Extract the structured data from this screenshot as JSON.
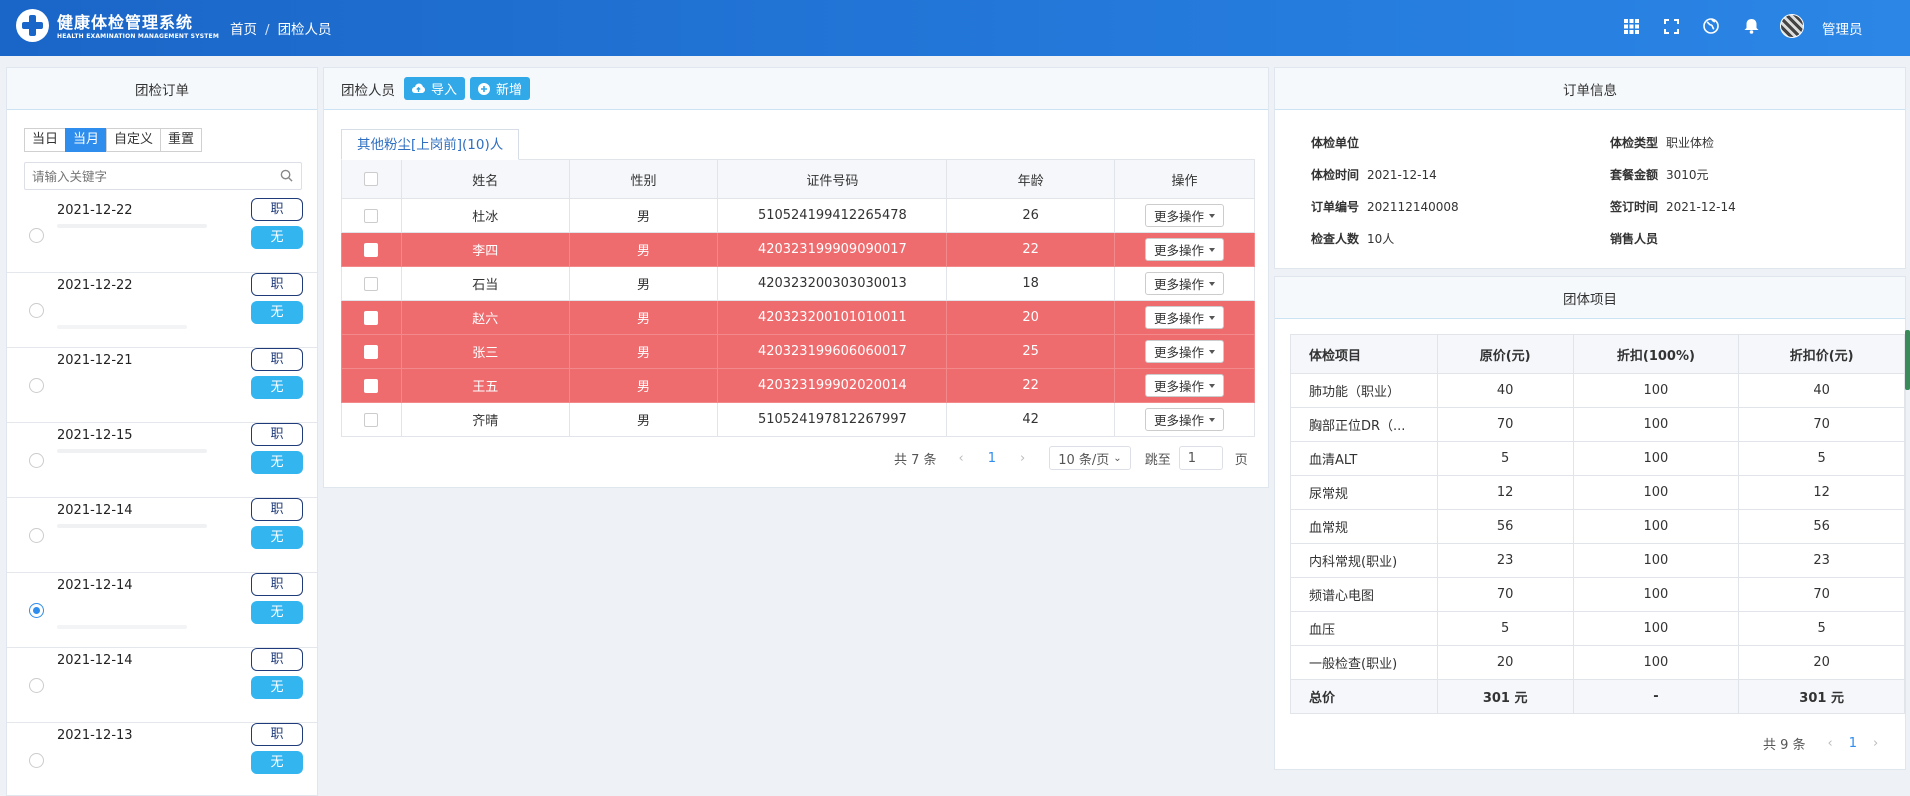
{
  "app": {
    "title": "健康体检管理系统",
    "subtitle": "HEALTH EXAMINATION MANAGEMENT SYSTEM"
  },
  "breadcrumb": {
    "home": "首页",
    "separator": "/",
    "current": "团检人员"
  },
  "header": {
    "user": "管理员",
    "icons": [
      "grid-icon",
      "fullscreen-icon",
      "globe-icon",
      "bell-icon"
    ]
  },
  "left": {
    "title": "团检订单",
    "tabs": [
      "当日",
      "当月",
      "自定义",
      "重置"
    ],
    "active_tab": "当月",
    "search_placeholder": "请输入关键字",
    "orders": [
      {
        "date": "2021-12-22",
        "tag1": "职",
        "tag2": "无",
        "selected": false
      },
      {
        "date": "2021-12-22",
        "tag1": "职",
        "tag2": "无",
        "selected": false
      },
      {
        "date": "2021-12-21",
        "tag1": "职",
        "tag2": "无",
        "selected": false
      },
      {
        "date": "2021-12-15",
        "tag1": "职",
        "tag2": "无",
        "selected": false
      },
      {
        "date": "2021-12-14",
        "tag1": "职",
        "tag2": "无",
        "selected": false
      },
      {
        "date": "2021-12-14",
        "tag1": "职",
        "tag2": "无",
        "selected": true
      },
      {
        "date": "2021-12-14",
        "tag1": "职",
        "tag2": "无",
        "selected": false
      },
      {
        "date": "2021-12-13",
        "tag1": "职",
        "tag2": "无",
        "selected": false
      }
    ]
  },
  "middle": {
    "title": "团检人员",
    "import_label": "导入",
    "add_label": "新增",
    "group_tab": "其他粉尘[上岗前](10)人",
    "columns": [
      "姓名",
      "性别",
      "证件号码",
      "年龄",
      "操作"
    ],
    "rows": [
      {
        "name": "杜冰",
        "gender": "男",
        "id": "510524199412265478",
        "age": "26",
        "action": "更多操作",
        "highlight": false
      },
      {
        "name": "李四",
        "gender": "男",
        "id": "420323199909090017",
        "age": "22",
        "action": "更多操作",
        "highlight": true
      },
      {
        "name": "石当",
        "gender": "男",
        "id": "420323200303030013",
        "age": "18",
        "action": "更多操作",
        "highlight": false
      },
      {
        "name": "赵六",
        "gender": "男",
        "id": "420323200101010011",
        "age": "20",
        "action": "更多操作",
        "highlight": true
      },
      {
        "name": "张三",
        "gender": "男",
        "id": "420323199606060017",
        "age": "25",
        "action": "更多操作",
        "highlight": true
      },
      {
        "name": "王五",
        "gender": "男",
        "id": "420323199902020014",
        "age": "22",
        "action": "更多操作",
        "highlight": true
      },
      {
        "name": "齐晴",
        "gender": "男",
        "id": "510524197812267997",
        "age": "42",
        "action": "更多操作",
        "highlight": false
      }
    ],
    "pager": {
      "total": "共 7 条",
      "prev": "‹",
      "page": "1",
      "next": "›",
      "size": "10 条/页",
      "goto": "跳至",
      "goto_value": "1",
      "unit": "页"
    }
  },
  "order_info": {
    "title": "订单信息",
    "fields": [
      {
        "label": "体检单位",
        "value": ""
      },
      {
        "label": "体检类型",
        "value": "职业体检"
      },
      {
        "label": "体检时间",
        "value": "2021-12-14"
      },
      {
        "label": "套餐金额",
        "value": "3010元"
      },
      {
        "label": "订单编号",
        "value": "202112140008"
      },
      {
        "label": "签订时间",
        "value": "2021-12-14"
      },
      {
        "label": "检查人数",
        "value": "10人"
      },
      {
        "label": "销售人员",
        "value": ""
      }
    ]
  },
  "group_items": {
    "title": "团体项目",
    "columns": [
      "体检项目",
      "原价(元)",
      "折扣(100%)",
      "折扣价(元)"
    ],
    "rows": [
      {
        "item": "肺功能（职业）",
        "price": "40",
        "discount": "100",
        "final": "40"
      },
      {
        "item": "胸部正位DR（...",
        "price": "70",
        "discount": "100",
        "final": "70"
      },
      {
        "item": "血清ALT",
        "price": "5",
        "discount": "100",
        "final": "5"
      },
      {
        "item": "尿常规",
        "price": "12",
        "discount": "100",
        "final": "12"
      },
      {
        "item": "血常规",
        "price": "56",
        "discount": "100",
        "final": "56"
      },
      {
        "item": "内科常规(职业)",
        "price": "23",
        "discount": "100",
        "final": "23"
      },
      {
        "item": "频谱心电图",
        "price": "70",
        "discount": "100",
        "final": "70"
      },
      {
        "item": "血压",
        "price": "5",
        "discount": "100",
        "final": "5"
      },
      {
        "item": "一般检查(职业)",
        "price": "20",
        "discount": "100",
        "final": "20"
      }
    ],
    "total": {
      "label": "总价",
      "price": "301 元",
      "discount": "-",
      "final": "301 元"
    },
    "pager": {
      "total": "共 9 条",
      "prev": "‹",
      "page": "1",
      "next": "›"
    }
  },
  "colors": {
    "header": "#1a66c8",
    "accent": "#2e8ded",
    "highlight_row": "#ee6b6e",
    "tag_blue": "#33b5f0"
  }
}
